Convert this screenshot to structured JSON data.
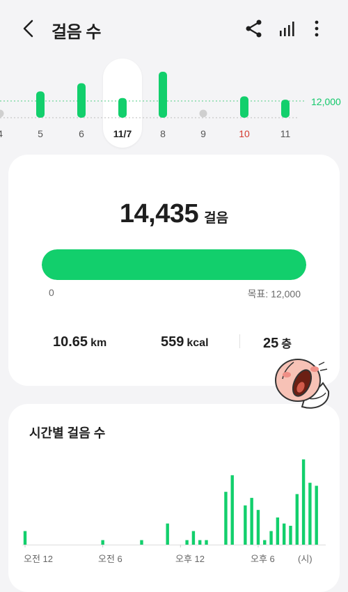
{
  "header": {
    "title": "걸음 수",
    "icons": [
      "back-arrow-icon",
      "share-icon",
      "bar-chart-icon",
      "more-vert-icon"
    ]
  },
  "week": {
    "goal_label": "12,000",
    "selected_day": "11/7",
    "days": [
      {
        "label": "4",
        "steps": 0
      },
      {
        "label": "5",
        "steps": 8000
      },
      {
        "label": "6",
        "steps": 10500
      },
      {
        "label": "11/7",
        "steps": 6000
      },
      {
        "label": "8",
        "steps": 14000
      },
      {
        "label": "9",
        "steps": 0
      },
      {
        "label": "10",
        "steps": 6500
      },
      {
        "label": "11",
        "steps": 5500
      }
    ]
  },
  "summary": {
    "steps": "14,435",
    "steps_unit": "걸음",
    "progress_fraction": 1.0,
    "progress_min": "0",
    "goal_text": "목표: 12,000",
    "distance": "10.65",
    "distance_unit": "km",
    "calories": "559",
    "calories_unit": "kcal",
    "floors": "25",
    "floors_unit": "층"
  },
  "colors": {
    "accent_green": "#12cf6c",
    "sunday_red": "#d43a2f"
  },
  "chart_data": {
    "type": "bar",
    "title": "시간별 걸음 수",
    "x_tick_labels": [
      "오전 12",
      "오전 6",
      "오후 12",
      "오후 6",
      "(시)"
    ],
    "slots_per_hour": 2,
    "values": [
      180,
      0,
      0,
      0,
      0,
      0,
      0,
      0,
      0,
      0,
      0,
      0,
      0,
      0,
      0,
      0,
      0,
      0,
      0,
      0,
      0,
      0,
      0,
      0,
      0,
      0,
      0,
      0,
      0,
      0,
      0,
      0,
      0,
      0,
      0,
      0,
      0,
      0,
      0,
      0,
      0,
      0,
      0,
      0,
      0,
      0,
      0,
      0,
      0,
      0,
      0,
      0,
      0,
      0,
      0,
      0,
      0,
      0,
      0,
      0,
      0,
      0,
      0,
      0,
      0,
      0,
      0,
      0,
      0,
      0,
      0,
      0,
      0,
      0,
      0,
      0,
      0,
      0,
      0,
      0,
      0,
      0,
      0,
      0,
      0,
      0,
      0,
      0,
      0,
      0,
      0,
      0,
      0,
      0,
      0,
      0,
      0,
      0,
      0,
      0,
      0,
      0,
      0,
      0,
      0,
      0,
      0,
      0,
      0,
      0,
      0,
      0,
      0,
      0,
      0,
      0,
      0,
      0,
      0,
      0,
      0,
      0,
      0,
      0,
      0,
      0,
      0,
      0,
      0,
      0,
      0,
      0,
      0,
      0,
      0,
      0,
      0,
      0,
      0,
      0,
      0,
      0,
      0,
      0
    ],
    "bars": [
      {
        "hour": 0.0,
        "value": 180
      },
      {
        "hour": 6.0,
        "value": 60
      },
      {
        "hour": 9.0,
        "value": 60
      },
      {
        "hour": 11.0,
        "value": 280
      },
      {
        "hour": 12.5,
        "value": 60
      },
      {
        "hour": 13.0,
        "value": 180
      },
      {
        "hour": 13.5,
        "value": 60
      },
      {
        "hour": 14.0,
        "value": 60
      },
      {
        "hour": 15.5,
        "value": 700
      },
      {
        "hour": 16.0,
        "value": 920
      },
      {
        "hour": 17.0,
        "value": 520
      },
      {
        "hour": 17.5,
        "value": 620
      },
      {
        "hour": 18.0,
        "value": 460
      },
      {
        "hour": 18.5,
        "value": 60
      },
      {
        "hour": 19.0,
        "value": 180
      },
      {
        "hour": 19.5,
        "value": 360
      },
      {
        "hour": 20.0,
        "value": 280
      },
      {
        "hour": 20.5,
        "value": 250
      },
      {
        "hour": 21.0,
        "value": 670
      },
      {
        "hour": 21.5,
        "value": 1130
      },
      {
        "hour": 22.0,
        "value": 820
      },
      {
        "hour": 22.5,
        "value": 780
      }
    ],
    "xlim": [
      0,
      23
    ],
    "ylim": [
      0,
      1200
    ]
  }
}
